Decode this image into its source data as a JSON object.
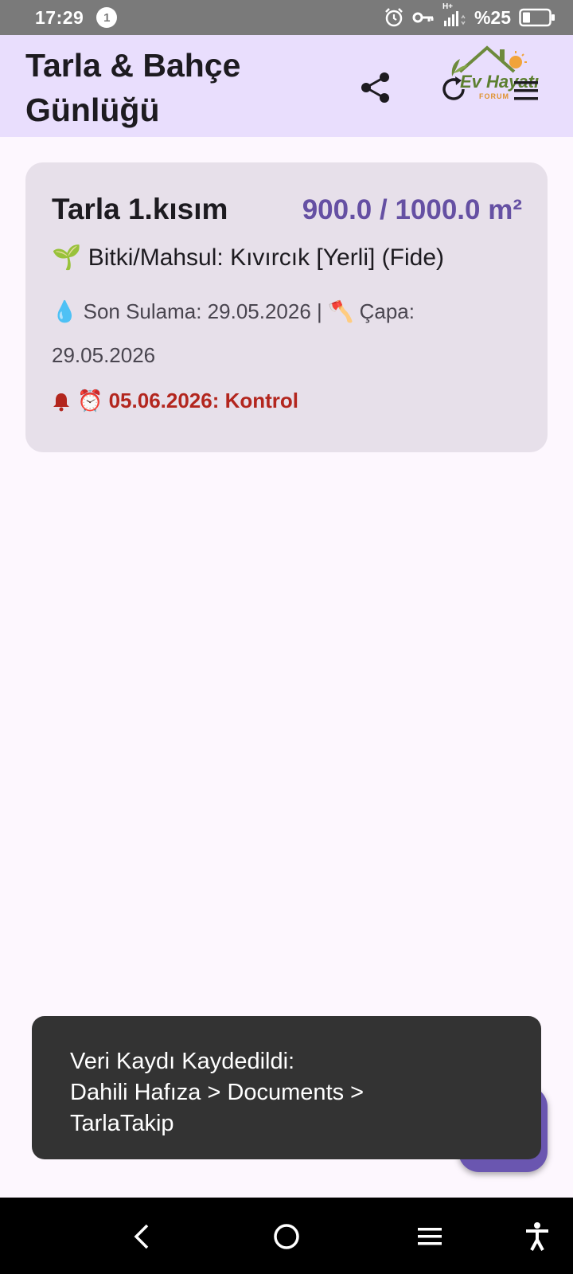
{
  "status_bar": {
    "time": "17:29",
    "notification_count": "1",
    "signal_type": "H+",
    "battery": "%25"
  },
  "app_bar": {
    "title": "Tarla & Bahçe Günlüğü",
    "logo_text": "Ev Hayatı",
    "logo_subtext": "FORUM"
  },
  "field_card": {
    "name": "Tarla 1.kısım",
    "area": "900.0 / 1000.0 m²",
    "crop": "🌱 Bitki/Mahsul: Kıvırcık  [Yerli] (Fide)",
    "care": "💧 Son Sulama: 29.05.2026 | 🪓 Çapa: 29.05.2026",
    "reminder": "⏰️ 05.06.2026: Kontrol"
  },
  "toast": {
    "line1": "Veri Kaydı Kaydedildi:",
    "line2": "Dahili Hafıza > Documents >",
    "line3": "TarlaTakip"
  },
  "colors": {
    "app_bar": "#e9defd",
    "card": "#e7e0ea",
    "accent": "#6550a3",
    "reminder": "#b3261e",
    "toast": "#333333"
  }
}
